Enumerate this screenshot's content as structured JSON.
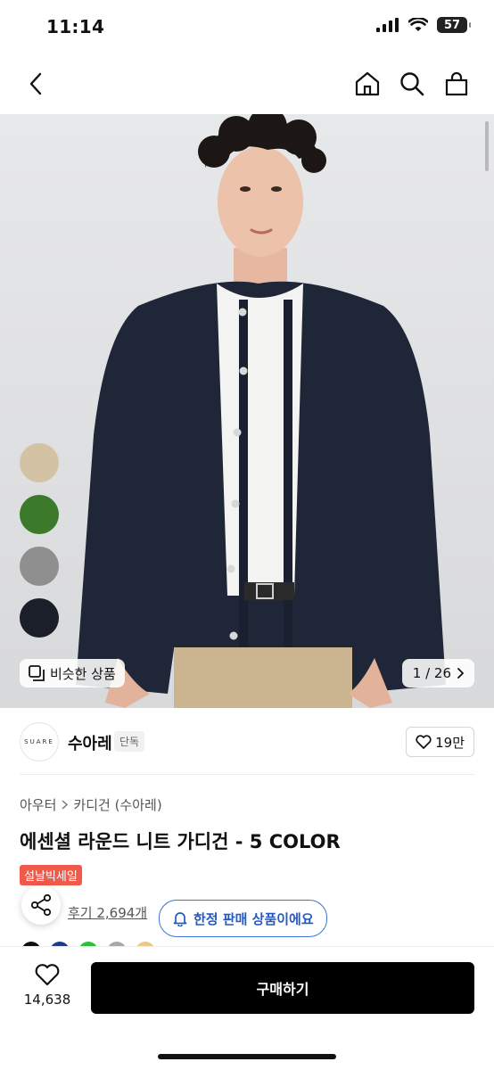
{
  "status_bar": {
    "time": "11:14",
    "battery": "57"
  },
  "hero": {
    "swatch_colors": [
      "#d4c2a4",
      "#3b7a2a",
      "#8f8f8f",
      "#1b1f2a"
    ],
    "similar_label": "비슷한 상품",
    "page_counter": "1 / 26"
  },
  "brand": {
    "logo_text": "SUARE",
    "name": "수아레",
    "badge": "단독",
    "likes": "19만"
  },
  "breadcrumb": {
    "level1": "아우터",
    "level2": "카디건 (수아레)"
  },
  "product": {
    "title": "에센셜 라운드 니트 가디건 - 5 COLOR",
    "sale_badge": "설날빅세일",
    "reviews": "후기 2,694개",
    "limited_label": "한정 판매 상품이에요",
    "color_dots": [
      "#111111",
      "#1f3b8a",
      "#2fbf3a",
      "#a8a8a8",
      "#e8c98a"
    ]
  },
  "bottom": {
    "wish_count": "14,638",
    "buy_label": "구매하기"
  },
  "colors": {
    "buy": "#000000",
    "sale": "#f05a4a",
    "limited": "#3b73d9"
  }
}
